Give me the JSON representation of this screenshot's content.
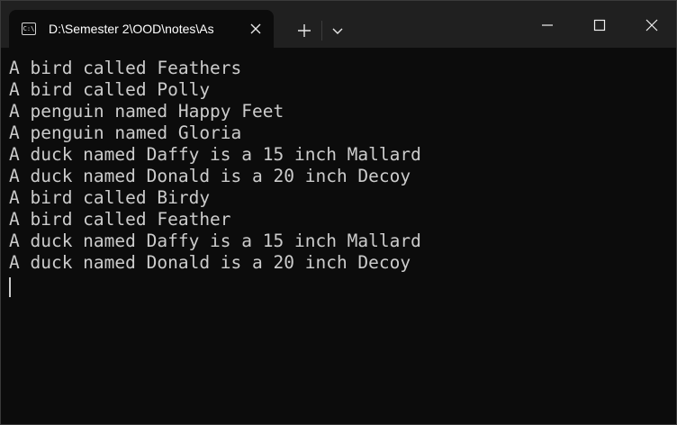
{
  "window": {
    "tab_title": "D:\\Semester 2\\OOD\\notes\\As",
    "tab_icon_text": "C:\\",
    "icons": {
      "tab": "command-prompt-icon",
      "tab_close": "close-icon",
      "new_tab": "plus-icon",
      "dropdown": "chevron-down-icon",
      "minimize": "minimize-icon",
      "maximize": "maximize-icon",
      "close": "close-icon"
    }
  },
  "terminal": {
    "lines": [
      "A bird called Feathers",
      "A bird called Polly",
      "A penguin named Happy Feet",
      "A penguin named Gloria",
      "A duck named Daffy is a 15 inch Mallard",
      "A duck named Donald is a 20 inch Decoy",
      "A bird called Birdy",
      "A bird called Feather",
      "A duck named Daffy is a 15 inch Mallard",
      "A duck named Donald is a 20 inch Decoy"
    ]
  },
  "colors": {
    "background": "#0c0c0c",
    "titlebar": "#202020",
    "text": "#cccccc"
  }
}
